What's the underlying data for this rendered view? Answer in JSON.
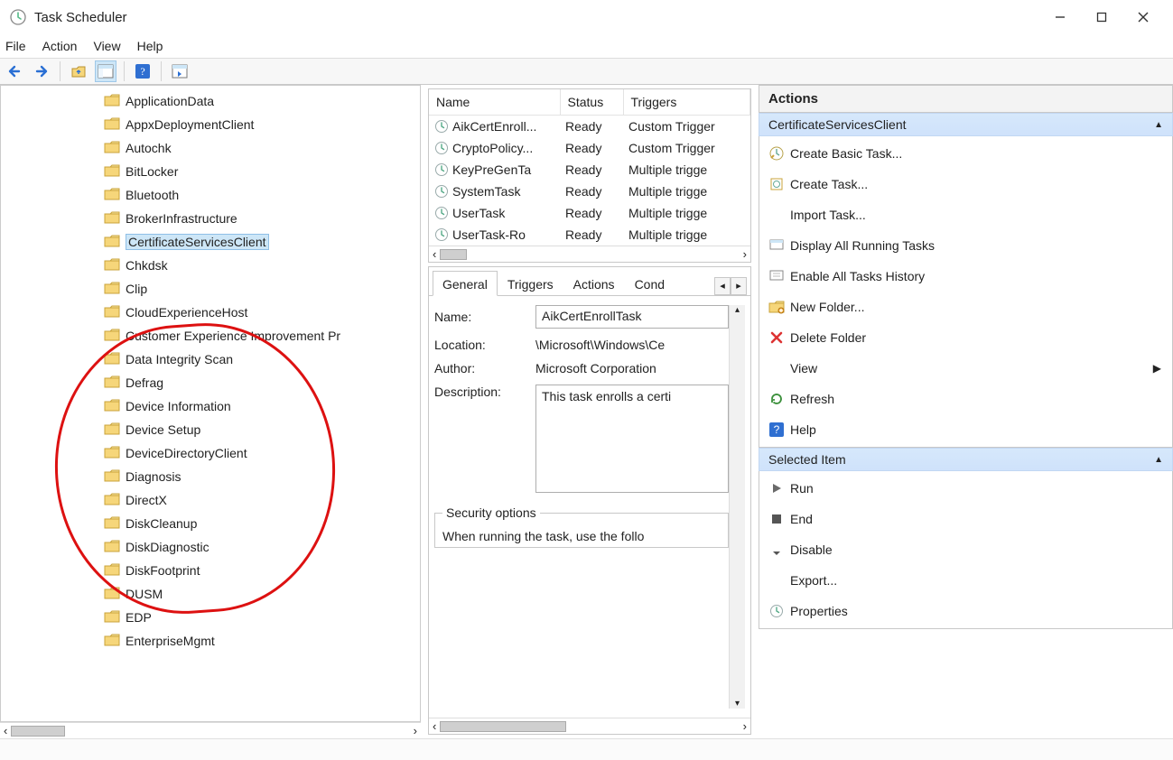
{
  "window": {
    "title": "Task Scheduler"
  },
  "menu": [
    "File",
    "Action",
    "View",
    "Help"
  ],
  "tree": {
    "items": [
      "ApplicationData",
      "AppxDeploymentClient",
      "Autochk",
      "BitLocker",
      "Bluetooth",
      "BrokerInfrastructure",
      "CertificateServicesClient",
      "Chkdsk",
      "Clip",
      "CloudExperienceHost",
      "Customer Experience Improvement Pr",
      "Data Integrity Scan",
      "Defrag",
      "Device Information",
      "Device Setup",
      "DeviceDirectoryClient",
      "Diagnosis",
      "DirectX",
      "DiskCleanup",
      "DiskDiagnostic",
      "DiskFootprint",
      "DUSM",
      "EDP",
      "EnterpriseMgmt"
    ],
    "selected_index": 6
  },
  "tasklist": {
    "columns": [
      "Name",
      "Status",
      "Triggers"
    ],
    "rows": [
      {
        "name": "AikCertEnroll...",
        "status": "Ready",
        "triggers": "Custom Trigger"
      },
      {
        "name": "CryptoPolicy...",
        "status": "Ready",
        "triggers": "Custom Trigger"
      },
      {
        "name": "KeyPreGenTa",
        "status": "Ready",
        "triggers": "Multiple trigge"
      },
      {
        "name": "SystemTask",
        "status": "Ready",
        "triggers": "Multiple trigge"
      },
      {
        "name": "UserTask",
        "status": "Ready",
        "triggers": "Multiple trigge"
      },
      {
        "name": "UserTask-Ro",
        "status": "Ready",
        "triggers": "Multiple trigge"
      }
    ]
  },
  "detail": {
    "tabs": [
      "General",
      "Triggers",
      "Actions",
      "Cond"
    ],
    "active_tab": 0,
    "name_label": "Name:",
    "name_val": "AikCertEnrollTask",
    "location_label": "Location:",
    "location_val": "\\Microsoft\\Windows\\Ce",
    "author_label": "Author:",
    "author_val": "Microsoft Corporation",
    "description_label": "Description:",
    "description_val": "This task enrolls a certi",
    "sec_legend": "Security options",
    "sec_text": "When running the task, use the follo"
  },
  "actions": {
    "header": "Actions",
    "groups": [
      {
        "title": "CertificateServicesClient",
        "items": [
          {
            "icon": "wizard",
            "label": "Create Basic Task..."
          },
          {
            "icon": "task",
            "label": "Create Task..."
          },
          {
            "icon": "blank",
            "label": "Import Task..."
          },
          {
            "icon": "display",
            "label": "Display All Running Tasks"
          },
          {
            "icon": "history",
            "label": "Enable All Tasks History"
          },
          {
            "icon": "newfolder",
            "label": "New Folder..."
          },
          {
            "icon": "delete",
            "label": "Delete Folder"
          },
          {
            "icon": "blank",
            "label": "View",
            "arrow": true
          },
          {
            "icon": "refresh",
            "label": "Refresh"
          },
          {
            "icon": "help",
            "label": "Help"
          }
        ]
      },
      {
        "title": "Selected Item",
        "items": [
          {
            "icon": "run",
            "label": "Run"
          },
          {
            "icon": "end",
            "label": "End"
          },
          {
            "icon": "disable",
            "label": "Disable"
          },
          {
            "icon": "blank",
            "label": "Export..."
          },
          {
            "icon": "props",
            "label": "Properties"
          }
        ]
      }
    ]
  }
}
